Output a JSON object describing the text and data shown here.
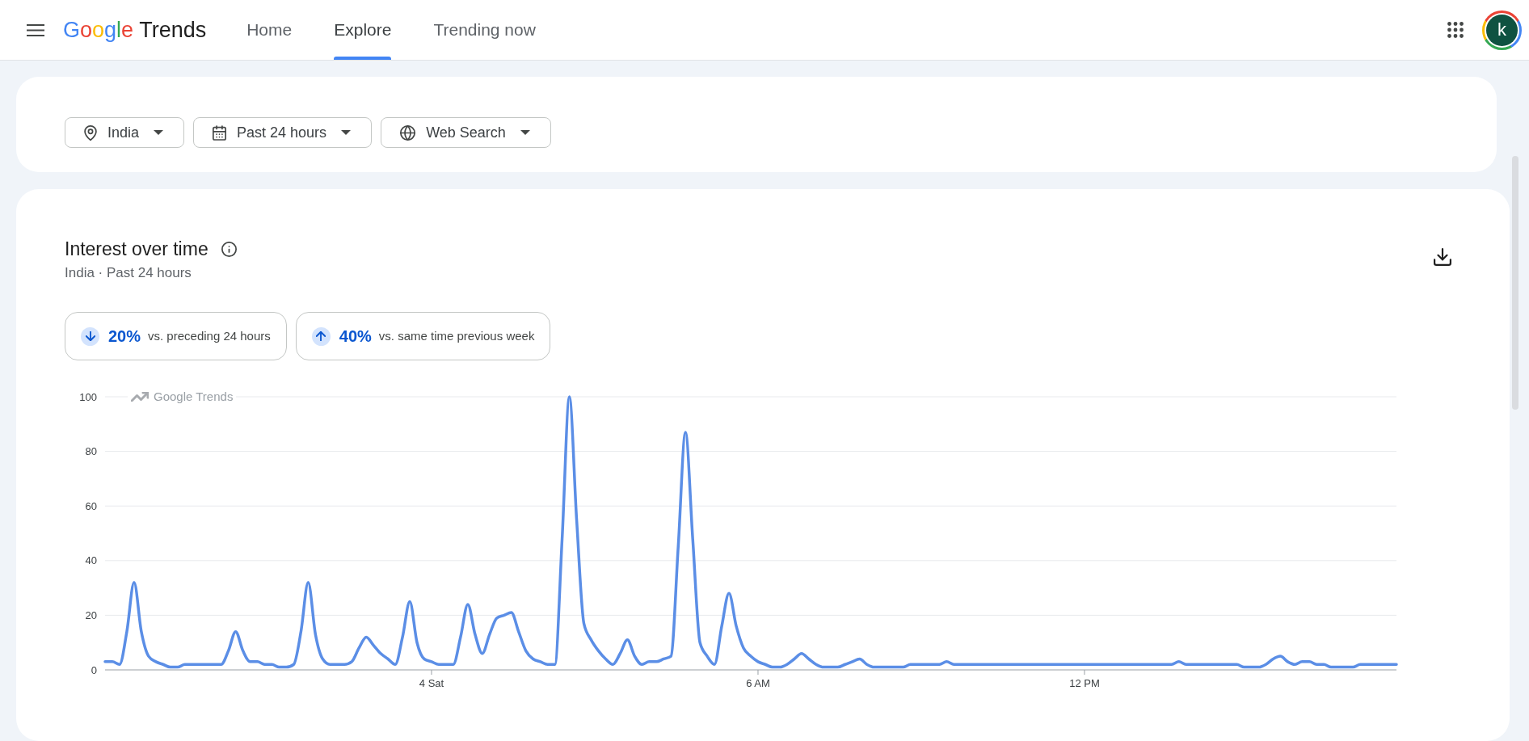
{
  "header": {
    "logo": {
      "brand": "Google",
      "product": "Trends"
    },
    "nav": [
      {
        "label": "Home",
        "selected": false
      },
      {
        "label": "Explore",
        "selected": true
      },
      {
        "label": "Trending now",
        "selected": false
      }
    ],
    "avatar": {
      "letter": "k"
    }
  },
  "filters": [
    {
      "kind": "location",
      "label": "India"
    },
    {
      "kind": "period",
      "label": "Past 24 hours"
    },
    {
      "kind": "source",
      "label": "Web Search"
    }
  ],
  "interest_over_time": {
    "title": "Interest over time",
    "subtitle": "India · Past 24 hours",
    "comparisons": [
      {
        "kind": "decrease",
        "value": "20%",
        "label": "vs. preceding 24 hours"
      },
      {
        "kind": "increase",
        "value": "40%",
        "label": "vs. same time previous week"
      }
    ],
    "chart_brand": "Google Trends",
    "chart_data": {
      "type": "line",
      "grid": true,
      "categories": [
        null,
        null,
        null,
        null,
        null,
        null,
        null,
        null,
        null,
        null,
        null,
        null,
        null,
        null,
        null,
        null,
        null,
        null,
        null,
        null,
        null,
        null,
        null,
        null,
        null,
        null,
        null,
        null,
        null,
        null,
        null,
        null,
        null,
        null,
        null,
        null,
        null,
        null,
        null,
        null,
        null,
        null,
        null,
        null,
        null,
        "4 Sat",
        null,
        null,
        null,
        null,
        null,
        null,
        null,
        null,
        null,
        null,
        null,
        null,
        null,
        null,
        null,
        null,
        null,
        null,
        null,
        null,
        null,
        null,
        null,
        null,
        null,
        null,
        null,
        null,
        null,
        null,
        null,
        null,
        null,
        null,
        null,
        null,
        null,
        null,
        null,
        null,
        null,
        null,
        null,
        null,
        "6 AM",
        null,
        null,
        null,
        null,
        null,
        null,
        null,
        null,
        null,
        null,
        null,
        null,
        null,
        null,
        null,
        null,
        null,
        null,
        null,
        null,
        null,
        null,
        null,
        null,
        null,
        null,
        null,
        null,
        null,
        null,
        null,
        null,
        null,
        null,
        null,
        null,
        null,
        null,
        null,
        null,
        null,
        null,
        null,
        null,
        "12 PM",
        null,
        null,
        null,
        null,
        null,
        null,
        null,
        null,
        null,
        null,
        null,
        null,
        null,
        null,
        null,
        null,
        null,
        null,
        null,
        null,
        null,
        null,
        null,
        null,
        null,
        null,
        null,
        null,
        null,
        null,
        null,
        null,
        null,
        null,
        null,
        null,
        null,
        null,
        null,
        null,
        null,
        null,
        null
      ],
      "ylim": [
        0,
        100
      ],
      "yticks": [
        0,
        20,
        40,
        60,
        80,
        100
      ],
      "series": [
        {
          "color": "#5b8ee6",
          "values": [
            3,
            3,
            2,
            14,
            32,
            14,
            5,
            3,
            2,
            1,
            1,
            2,
            2,
            2,
            2,
            2,
            2,
            7,
            14,
            7,
            3,
            3,
            2,
            2,
            1,
            1,
            2,
            14,
            32,
            13,
            4,
            2,
            2,
            2,
            3,
            8,
            12,
            9,
            6,
            4,
            2,
            12,
            25,
            10,
            4,
            3,
            2,
            2,
            2,
            12,
            24,
            13,
            6,
            13,
            19,
            20,
            21,
            14,
            7,
            4,
            3,
            2,
            2,
            48,
            100,
            55,
            17,
            11,
            7,
            4,
            2,
            6,
            11,
            5,
            2,
            3,
            3,
            4,
            5,
            45,
            87,
            48,
            10,
            5,
            2,
            16,
            28,
            16,
            8,
            5,
            3,
            2,
            1,
            1,
            2,
            4,
            6,
            4,
            2,
            1,
            1,
            1,
            2,
            3,
            4,
            2,
            1,
            1,
            1,
            1,
            1,
            2,
            2,
            2,
            2,
            2,
            3,
            2,
            2,
            2,
            2,
            2,
            2,
            2,
            2,
            2,
            2,
            2,
            2,
            2,
            2,
            2,
            2,
            2,
            2,
            2,
            2,
            2,
            2,
            2,
            2,
            2,
            2,
            2,
            2,
            2,
            2,
            2,
            3,
            2,
            2,
            2,
            2,
            2,
            2,
            2,
            2,
            1,
            1,
            1,
            2,
            4,
            5,
            3,
            2,
            3,
            3,
            2,
            2,
            1,
            1,
            1,
            1,
            2,
            2,
            2,
            2,
            2,
            2
          ]
        }
      ]
    }
  }
}
